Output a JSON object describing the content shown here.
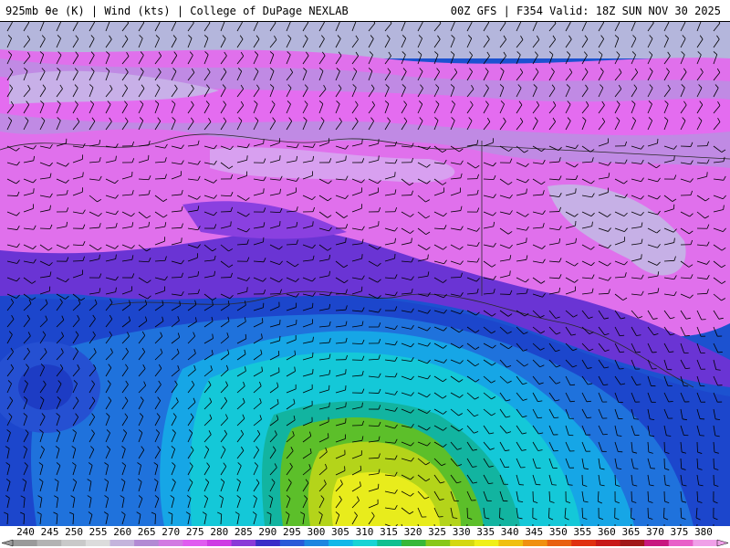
{
  "header": {
    "left_text": "925mb θe (K) | Wind (kts) | College of DuPage NEXLAB",
    "right_text": "00Z GFS | F354 Valid: 18Z SUN NOV 30 2025"
  },
  "map": {
    "field": "925mb equivalent potential temperature",
    "overlay": "wind barbs",
    "region": "Alaska and North Pacific"
  },
  "colorbar": {
    "labels": [
      "240",
      "245",
      "250",
      "255",
      "260",
      "265",
      "270",
      "275",
      "280",
      "285",
      "290",
      "295",
      "300",
      "305",
      "310",
      "315",
      "320",
      "325",
      "330",
      "335",
      "340",
      "345",
      "350",
      "355",
      "360",
      "365",
      "370",
      "375",
      "380"
    ],
    "colors": [
      "#9a9a9a",
      "#b3b3b3",
      "#c9c9c9",
      "#dcdcdc",
      "#c4b4dc",
      "#b28ad4",
      "#d27ae2",
      "#e05cf0",
      "#ce3ce4",
      "#8a3ad8",
      "#3a2cc8",
      "#2a5ad8",
      "#1d86e0",
      "#12b8e8",
      "#18d4d4",
      "#10c090",
      "#38b838",
      "#88c818",
      "#d4d810",
      "#f0f018",
      "#f0c010",
      "#f09010",
      "#e86010",
      "#e03010",
      "#c81818",
      "#a01818",
      "#c81880",
      "#e860c8",
      "#f0a0e8"
    ]
  }
}
